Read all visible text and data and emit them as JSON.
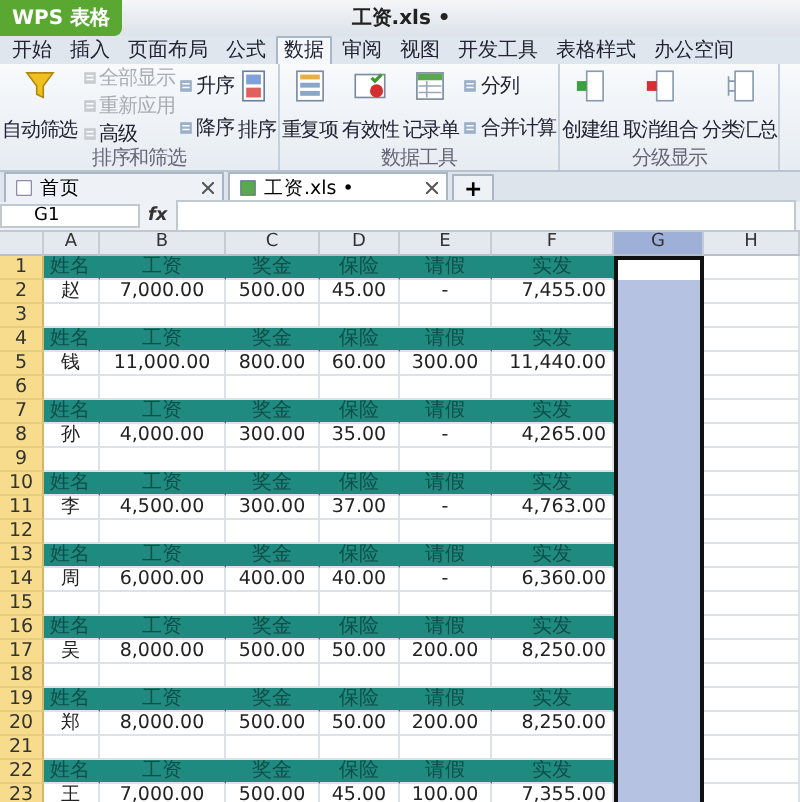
{
  "title_bar": {
    "app_button": "WPS 表格",
    "title": "工资.xls •"
  },
  "menu_tabs": [
    {
      "label": "开始",
      "selected": false
    },
    {
      "label": "插入",
      "selected": false
    },
    {
      "label": "页面布局",
      "selected": false
    },
    {
      "label": "公式",
      "selected": false
    },
    {
      "label": "数据",
      "selected": true
    },
    {
      "label": "审阅",
      "selected": false
    },
    {
      "label": "视图",
      "selected": false
    },
    {
      "label": "开发工具",
      "selected": false
    },
    {
      "label": "表格样式",
      "selected": false
    },
    {
      "label": "办公空间",
      "selected": false
    }
  ],
  "ribbon_groups": [
    {
      "label": "排序和筛选",
      "items": [
        {
          "kind": "large",
          "label": "自动筛选"
        },
        {
          "kind": "stack",
          "buttons": [
            {
              "label": "全部显示",
              "disabled": true
            },
            {
              "label": "重新应用",
              "disabled": true
            },
            {
              "label": "高级",
              "disabled": false
            }
          ]
        },
        {
          "kind": "stack",
          "buttons": [
            {
              "label": "升序",
              "disabled": false
            },
            {
              "label": "降序",
              "disabled": false
            }
          ]
        },
        {
          "kind": "large",
          "label": "排序"
        }
      ]
    },
    {
      "label": "数据工具",
      "items": [
        {
          "kind": "large",
          "label": "重复项"
        },
        {
          "kind": "large",
          "label": "有效性"
        },
        {
          "kind": "large",
          "label": "记录单"
        },
        {
          "kind": "stack",
          "buttons": [
            {
              "label": "分列",
              "disabled": false
            },
            {
              "label": "合并计算",
              "disabled": false
            }
          ]
        }
      ]
    },
    {
      "label": "分级显示",
      "items": [
        {
          "kind": "large",
          "label": "创建组"
        },
        {
          "kind": "large",
          "label": "取消组合"
        },
        {
          "kind": "large",
          "label": "分类汇总"
        }
      ]
    }
  ],
  "doc_tabs": [
    {
      "label": "首页",
      "selected": false
    },
    {
      "label": "工资.xls •",
      "selected": true
    }
  ],
  "new_tab": "+",
  "formula_bar": {
    "name_box": "G1",
    "fx": "fx"
  },
  "columns": [
    {
      "label": "A",
      "selected": false
    },
    {
      "label": "B",
      "selected": false
    },
    {
      "label": "C",
      "selected": false
    },
    {
      "label": "D",
      "selected": false
    },
    {
      "label": "E",
      "selected": false
    },
    {
      "label": "F",
      "selected": false
    },
    {
      "label": "G",
      "selected": true
    },
    {
      "label": "H",
      "selected": false
    }
  ],
  "rows": [
    {
      "number": "1",
      "kind": "header",
      "cells": [
        "姓名",
        "工资",
        "奖金",
        "保险",
        "请假",
        "实发"
      ]
    },
    {
      "number": "2",
      "kind": "data",
      "cells": [
        "赵",
        "7,000.00",
        "500.00",
        "45.00",
        "-",
        "7,455.00"
      ]
    },
    {
      "number": "3",
      "kind": "blank"
    },
    {
      "number": "4",
      "kind": "header",
      "cells": [
        "姓名",
        "工资",
        "奖金",
        "保险",
        "请假",
        "实发"
      ]
    },
    {
      "number": "5",
      "kind": "data",
      "cells": [
        "钱",
        "11,000.00",
        "800.00",
        "60.00",
        "300.00",
        "11,440.00"
      ]
    },
    {
      "number": "6",
      "kind": "blank"
    },
    {
      "number": "7",
      "kind": "header",
      "cells": [
        "姓名",
        "工资",
        "奖金",
        "保险",
        "请假",
        "实发"
      ]
    },
    {
      "number": "8",
      "kind": "data",
      "cells": [
        "孙",
        "4,000.00",
        "300.00",
        "35.00",
        "-",
        "4,265.00"
      ]
    },
    {
      "number": "9",
      "kind": "blank"
    },
    {
      "number": "10",
      "kind": "header",
      "cells": [
        "姓名",
        "工资",
        "奖金",
        "保险",
        "请假",
        "实发"
      ]
    },
    {
      "number": "11",
      "kind": "data",
      "cells": [
        "李",
        "4,500.00",
        "300.00",
        "37.00",
        "-",
        "4,763.00"
      ]
    },
    {
      "number": "12",
      "kind": "blank"
    },
    {
      "number": "13",
      "kind": "header",
      "cells": [
        "姓名",
        "工资",
        "奖金",
        "保险",
        "请假",
        "实发"
      ]
    },
    {
      "number": "14",
      "kind": "data",
      "cells": [
        "周",
        "6,000.00",
        "400.00",
        "40.00",
        "-",
        "6,360.00"
      ]
    },
    {
      "number": "15",
      "kind": "blank"
    },
    {
      "number": "16",
      "kind": "header",
      "cells": [
        "姓名",
        "工资",
        "奖金",
        "保险",
        "请假",
        "实发"
      ]
    },
    {
      "number": "17",
      "kind": "data",
      "cells": [
        "吴",
        "8,000.00",
        "500.00",
        "50.00",
        "200.00",
        "8,250.00"
      ]
    },
    {
      "number": "18",
      "kind": "blank"
    },
    {
      "number": "19",
      "kind": "header",
      "cells": [
        "姓名",
        "工资",
        "奖金",
        "保险",
        "请假",
        "实发"
      ]
    },
    {
      "number": "20",
      "kind": "data",
      "cells": [
        "郑",
        "8,000.00",
        "500.00",
        "50.00",
        "200.00",
        "8,250.00"
      ]
    },
    {
      "number": "21",
      "kind": "blank"
    },
    {
      "number": "22",
      "kind": "header",
      "cells": [
        "姓名",
        "工资",
        "奖金",
        "保险",
        "请假",
        "实发"
      ]
    },
    {
      "number": "23",
      "kind": "data",
      "cells": [
        "王",
        "7,000.00",
        "500.00",
        "45.00",
        "100.00",
        "7,355.00"
      ]
    }
  ]
}
